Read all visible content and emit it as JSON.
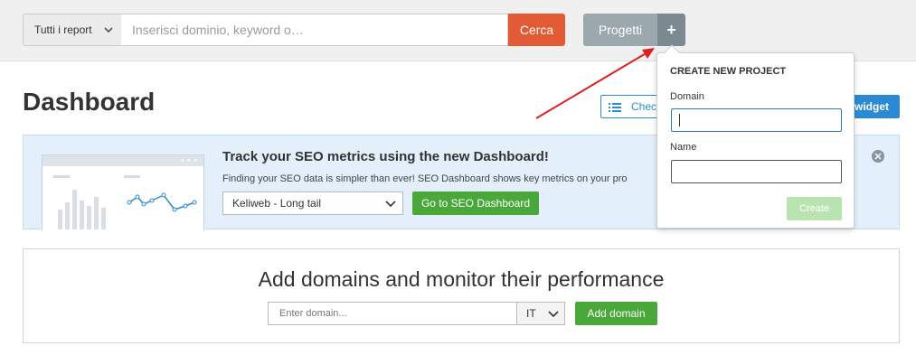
{
  "topbar": {
    "report_select": "Tutti i report",
    "search_placeholder": "Inserisci dominio, keyword o…",
    "search_button": "Cerca",
    "projects_button": "Progetti",
    "plus_button": "+"
  },
  "page": {
    "title": "Dashboard",
    "checklist_button": "Chec",
    "widget_button": "widget"
  },
  "banner": {
    "title": "Track your SEO metrics using the new Dashboard!",
    "text": "Finding your SEO data is simpler than ever! SEO Dashboard shows key metrics on your pro",
    "project_select": "Keliweb - Long tail",
    "go_button": "Go to SEO Dashboard"
  },
  "add_domains": {
    "title": "Add domains and monitor their performance",
    "domain_placeholder": "Enter domain...",
    "country": "IT",
    "add_button": "Add domain"
  },
  "popover": {
    "title": "CREATE NEW PROJECT",
    "domain_label": "Domain",
    "domain_value": "",
    "name_label": "Name",
    "name_value": "",
    "create_button": "Create"
  },
  "colors": {
    "search_button": "#e35b34",
    "projects_button": "#9ba8ad",
    "plus_button": "#7b8a90",
    "primary_blue": "#2b8ad4",
    "green": "#4aa83b",
    "banner_bg": "#e3f0fb",
    "annotation_arrow": "#e02020"
  },
  "icons": {
    "chevron": "chevron-down-icon",
    "list": "list-icon",
    "close": "close-circle-icon",
    "arrow": "annotation-arrow"
  }
}
